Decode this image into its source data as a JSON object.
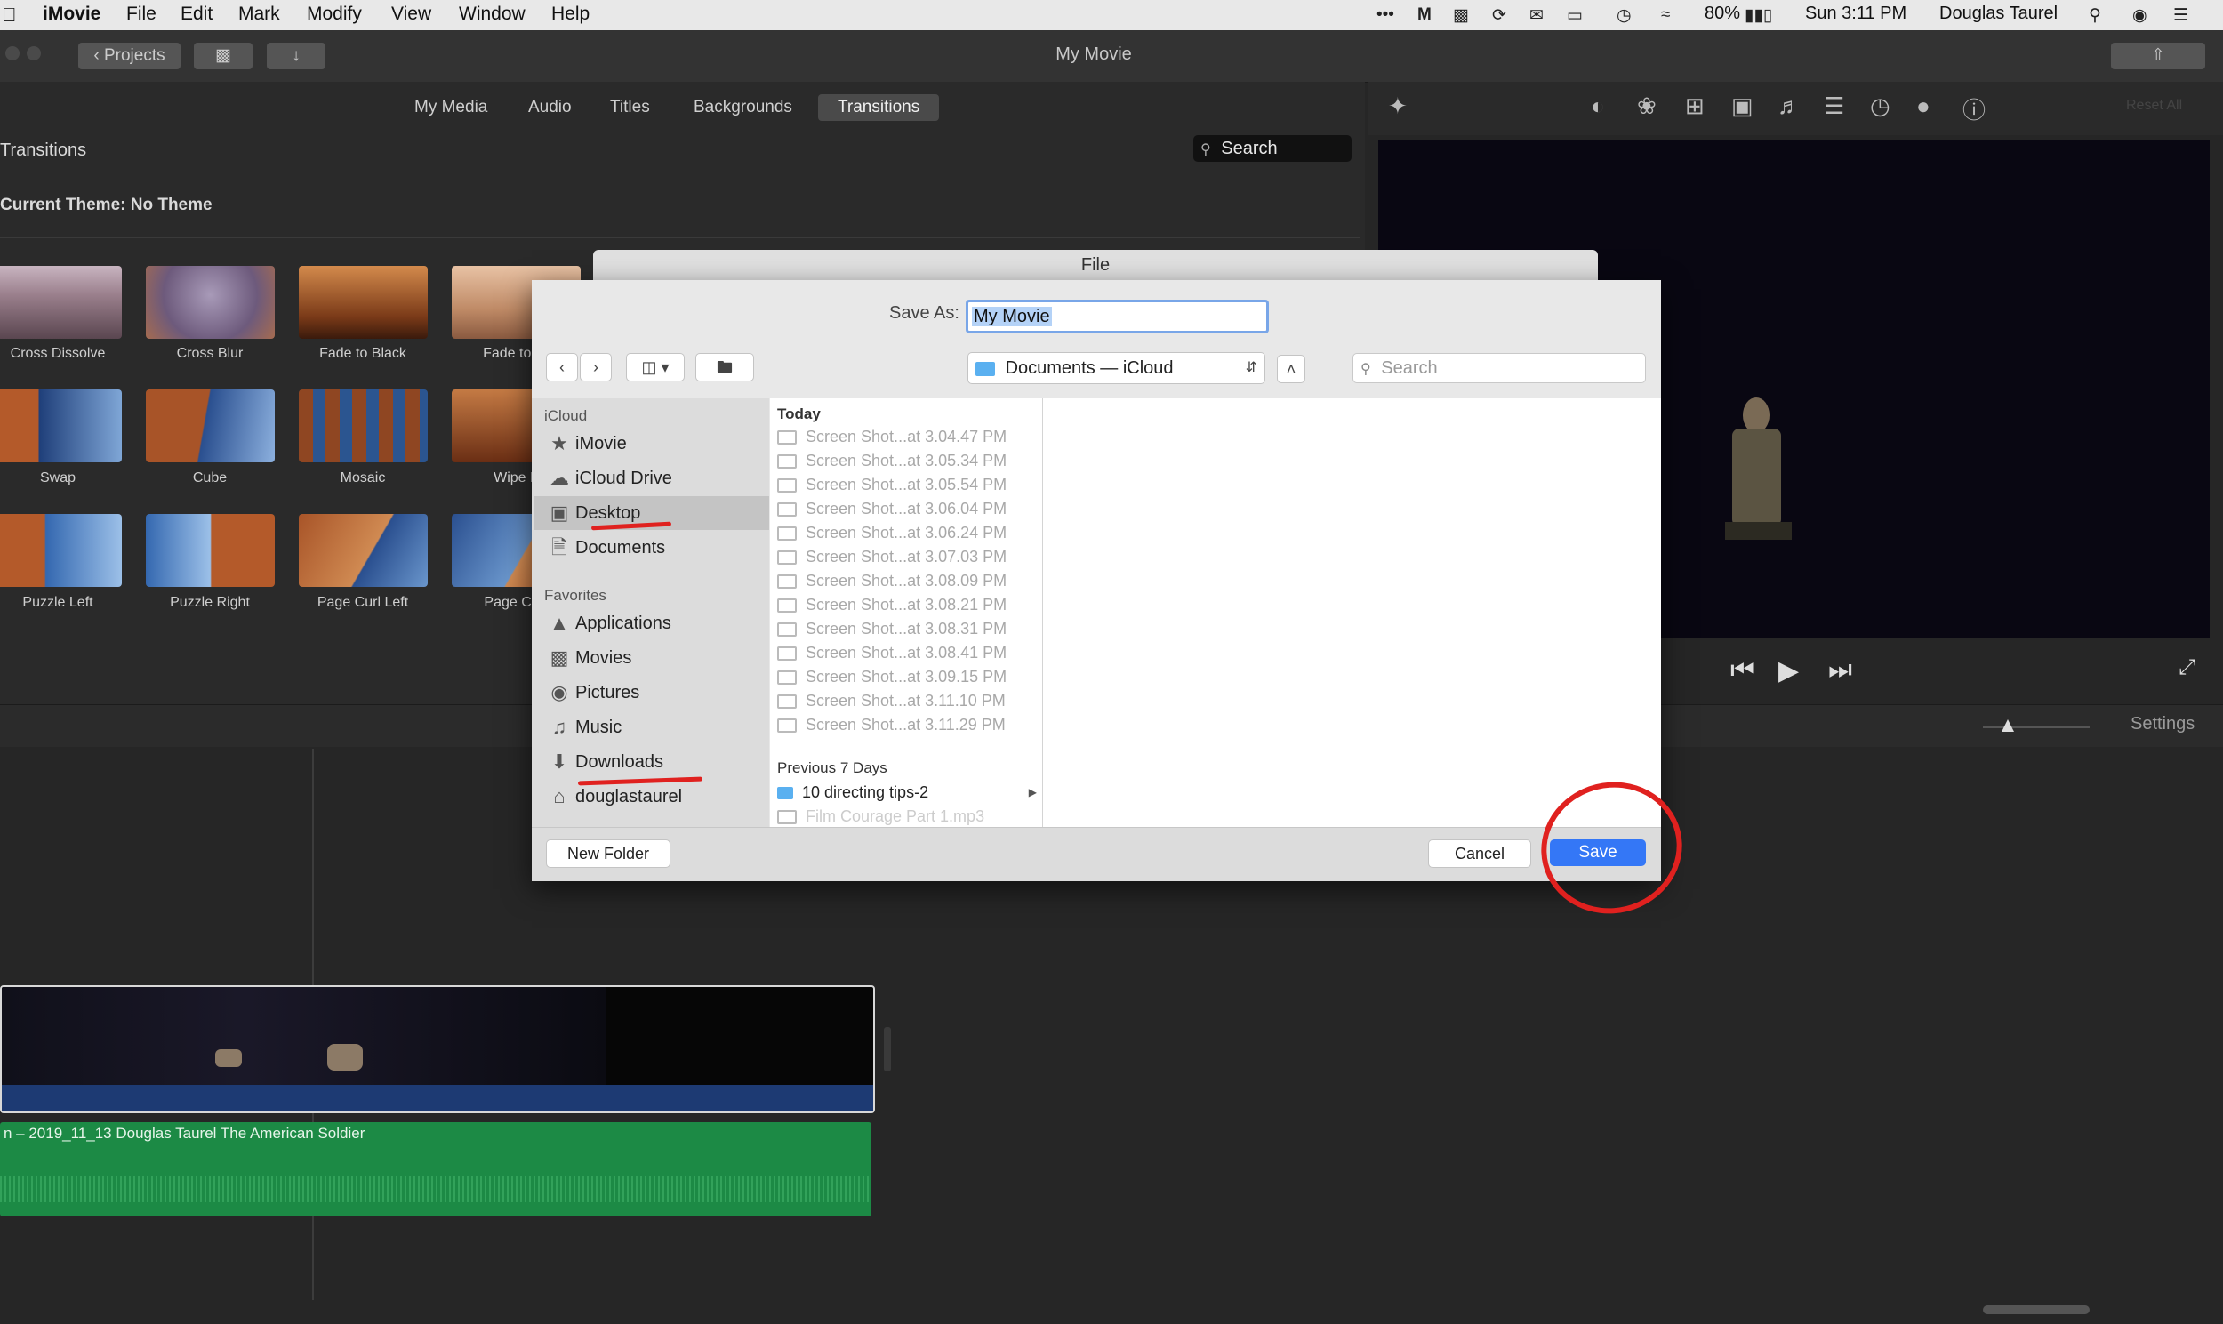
{
  "menubar": {
    "app": "iMovie",
    "menus": [
      "File",
      "Edit",
      "Mark",
      "Modify",
      "View",
      "Window",
      "Help"
    ],
    "battery": "80%",
    "clock": "Sun 3:11 PM",
    "user": "Douglas Taurel"
  },
  "toolbar": {
    "projects_label": "Projects",
    "window_title": "My Movie"
  },
  "browser": {
    "tabs": [
      "My Media",
      "Audio",
      "Titles",
      "Backgrounds",
      "Transitions"
    ],
    "active_tab": "Transitions",
    "section_title": "Transitions",
    "search_placeholder": "Search",
    "theme": "Current Theme: No Theme",
    "transitions": [
      {
        "label": "Cross Dissolve",
        "style": "forest"
      },
      {
        "label": "Cross Blur",
        "style": "blur"
      },
      {
        "label": "Fade to Black",
        "style": "warm"
      },
      {
        "label": "Fade to W",
        "style": "pale"
      },
      {
        "label": "Swap",
        "style": "swap"
      },
      {
        "label": "Cube",
        "style": "cube"
      },
      {
        "label": "Mosaic",
        "style": "mosaic"
      },
      {
        "label": "Wipe L",
        "style": "warm"
      },
      {
        "label": "Puzzle Left",
        "style": "puzzle"
      },
      {
        "label": "Puzzle Right",
        "style": "puzzle2"
      },
      {
        "label": "Page Curl Left",
        "style": "curl"
      },
      {
        "label": "Page Curl",
        "style": "curl2"
      }
    ]
  },
  "viewer": {
    "reset_all": "Reset All",
    "settings": "Settings"
  },
  "timeline": {
    "audio_clip_label": "n – 2019_11_13 Douglas Taurel The American Soldier"
  },
  "dialog": {
    "title": "File",
    "save_as_label": "Save As:",
    "save_as_value": "My Movie",
    "location": "Documents — iCloud",
    "search_placeholder": "Search",
    "sidebar": {
      "icloud_header": "iCloud",
      "icloud_items": [
        {
          "label": "iMovie",
          "icon": "imovie-icon"
        },
        {
          "label": "iCloud Drive",
          "icon": "cloud-icon"
        },
        {
          "label": "Desktop",
          "icon": "desktop-icon",
          "selected": true
        },
        {
          "label": "Documents",
          "icon": "document-icon"
        }
      ],
      "favorites_header": "Favorites",
      "favorite_items": [
        {
          "label": "Applications",
          "icon": "applications-icon"
        },
        {
          "label": "Movies",
          "icon": "movies-icon"
        },
        {
          "label": "Pictures",
          "icon": "camera-icon"
        },
        {
          "label": "Music",
          "icon": "music-icon"
        },
        {
          "label": "Downloads",
          "icon": "download-icon"
        },
        {
          "label": "douglastaurel",
          "icon": "home-icon"
        }
      ]
    },
    "files": {
      "today_header": "Today",
      "today": [
        "Screen Shot...at 3.04.47 PM",
        "Screen Shot...at 3.05.34 PM",
        "Screen Shot...at 3.05.54 PM",
        "Screen Shot...at 3.06.04 PM",
        "Screen Shot...at 3.06.24 PM",
        "Screen Shot...at 3.07.03 PM",
        "Screen Shot...at 3.08.09 PM",
        "Screen Shot...at 3.08.21 PM",
        "Screen Shot...at 3.08.31 PM",
        "Screen Shot...at 3.08.41 PM",
        "Screen Shot...at 3.09.15 PM",
        "Screen Shot...at 3.11.10 PM",
        "Screen Shot...at 3.11.29 PM"
      ],
      "prev_header": "Previous 7 Days",
      "prev": [
        "10 directing tips-2",
        "Film Courage Part 1.mp3"
      ]
    },
    "new_folder": "New Folder",
    "cancel": "Cancel",
    "save": "Save"
  },
  "colors": {
    "accent_blue": "#3477f6",
    "annotation_red": "#e0211f",
    "audio_green": "#1c8a45",
    "video_blue": "#1d3a73"
  }
}
